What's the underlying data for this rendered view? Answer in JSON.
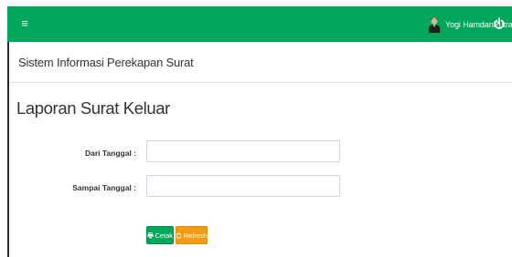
{
  "header": {
    "user_name": "Yogi HamdanPutra",
    "icons": {
      "menu": "hamburger-icon",
      "avatar": "user-avatar",
      "logout": "power-icon"
    },
    "accent_color": "#00a65a"
  },
  "app": {
    "title": "Sistem Informasi Perekapan Surat"
  },
  "page": {
    "title": "Laporan Surat Keluar"
  },
  "form": {
    "from_label": "Dari Tanggal :",
    "from_value": "",
    "to_label": "Sampai Tanggal :",
    "to_value": "",
    "print_button": "Cetak",
    "refresh_button": "Refresh",
    "print_icon": "printer-icon",
    "refresh_icon": "refresh-icon",
    "print_color": "#00a65a",
    "refresh_color": "#f39c12"
  }
}
